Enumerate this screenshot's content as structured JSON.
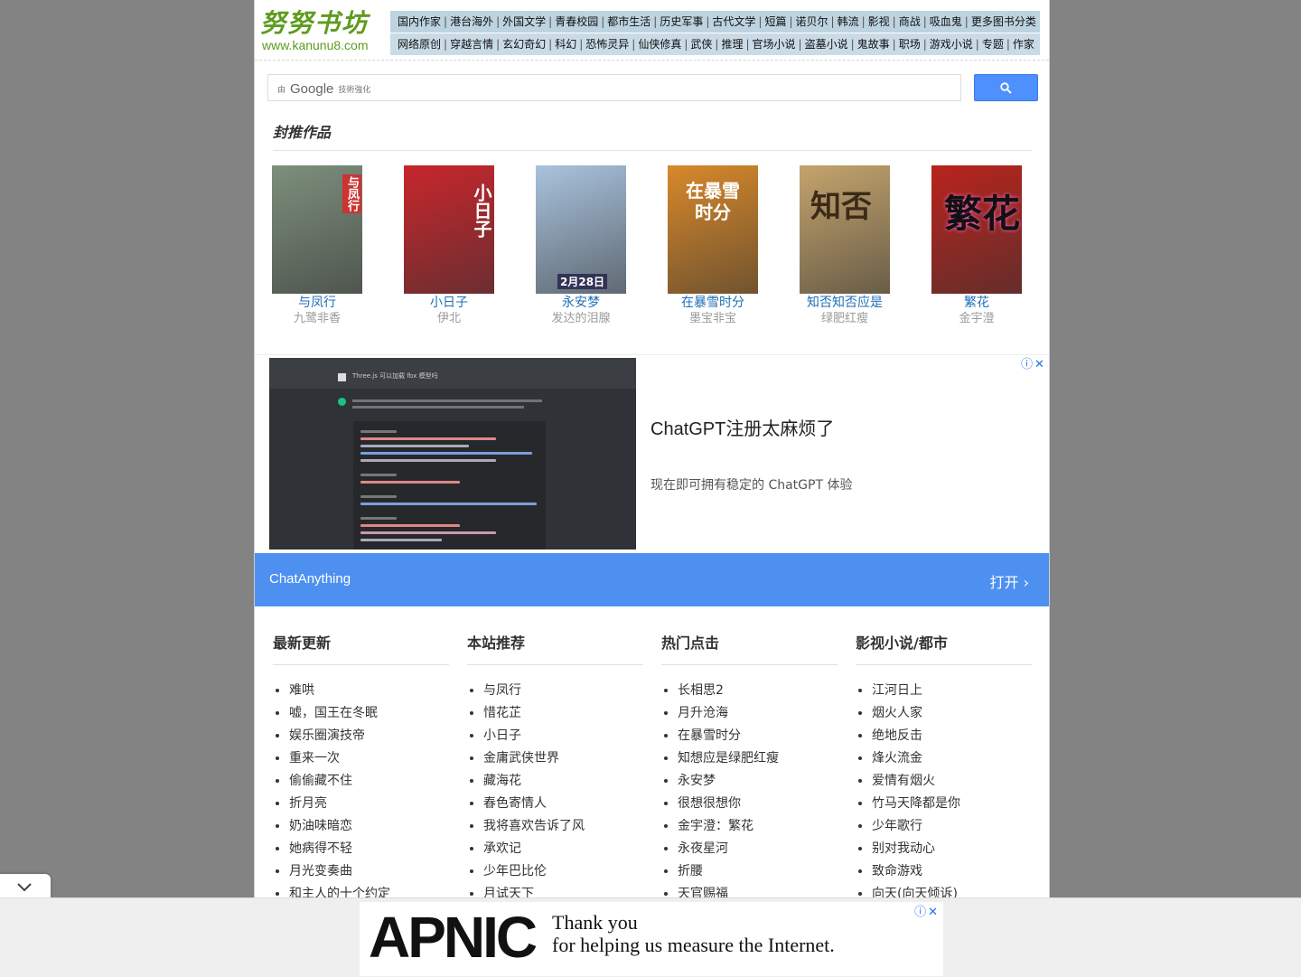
{
  "logo": {
    "name": "努努书坊",
    "url": "www.kanunu8.com"
  },
  "nav": {
    "row1": [
      "国内作家",
      "港台海外",
      "外国文学",
      "青春校园",
      "都市生活",
      "历史军事",
      "古代文学",
      "短篇",
      "诺贝尔",
      "韩流",
      "影视",
      "商战",
      "吸血鬼",
      "更多图书分类"
    ],
    "row2": [
      "网络原创",
      "穿越言情",
      "玄幻奇幻",
      "科幻",
      "恐怖灵异",
      "仙侠修真",
      "武侠",
      "推理",
      "官场小说",
      "盗墓小说",
      "鬼故事",
      "职场",
      "游戏小说",
      "专题",
      "作家"
    ]
  },
  "search": {
    "brand_prefix": "由",
    "brand_word": "Google",
    "brand_suffix": "技術強化"
  },
  "featured": {
    "title": "封推作品",
    "books": [
      {
        "title": "与凤行",
        "author": "九鹭非香",
        "cover_text": "与凤行",
        "color": "#7d8f7c"
      },
      {
        "title": "小日子",
        "author": "伊北",
        "cover_text": "小日子",
        "color": "#c8262c"
      },
      {
        "title": "永安梦",
        "author": "发达的泪腺",
        "cover_text": "2月28日",
        "color": "#a9c3dd"
      },
      {
        "title": "在暴雪时分",
        "author": "墨宝非宝",
        "cover_text": "在暴雪时分",
        "color": "#d8892a"
      },
      {
        "title": "知否知否应是",
        "author": "绿肥红瘦",
        "cover_text": "知否",
        "color": "#c4a46c"
      },
      {
        "title": "繁花",
        "author": "金宇澄",
        "cover_text": "繁花",
        "color": "#b8241c"
      }
    ]
  },
  "ad": {
    "code_title": "Three.js 可以加载 fbx 模型吗",
    "headline": "ChatGPT注册太麻烦了",
    "description": "现在即可拥有稳定的 ChatGPT 体验",
    "brand": "ChatAnything",
    "open_label": "打开"
  },
  "lists": [
    {
      "title": "最新更新",
      "items": [
        "难哄",
        "嘘，国王在冬眠",
        "娱乐圈演技帝",
        "重来一次",
        "偷偷藏不住",
        "折月亮",
        "奶油味暗恋",
        "她病得不轻",
        "月光变奏曲",
        "和主人的十个约定"
      ]
    },
    {
      "title": "本站推荐",
      "items": [
        "与凤行",
        "惜花芷",
        "小日子",
        "金庸武侠世界",
        "藏海花",
        "春色寄情人",
        "我将喜欢告诉了风",
        "承欢记",
        "少年巴比伦",
        "月试天下"
      ]
    },
    {
      "title": "热门点击",
      "items": [
        "长相思2",
        "月升沧海",
        "在暴雪时分",
        "知想应是绿肥红瘦",
        "永安梦",
        "很想很想你",
        "金宇澄：繁花",
        "永夜星河",
        "折腰",
        "天官赐福"
      ]
    },
    {
      "title": "影视小说/都市",
      "items": [
        "江河日上",
        "烟火人家",
        "绝地反击",
        "烽火流金",
        "爱情有烟火",
        "竹马天降都是你",
        "少年歌行",
        "别对我动心",
        "致命游戏",
        "向天(向天倾诉)"
      ]
    }
  ],
  "bottom_ad": {
    "logo": "APNIC",
    "line1": "Thank you",
    "line2": "for helping us measure the Internet."
  }
}
